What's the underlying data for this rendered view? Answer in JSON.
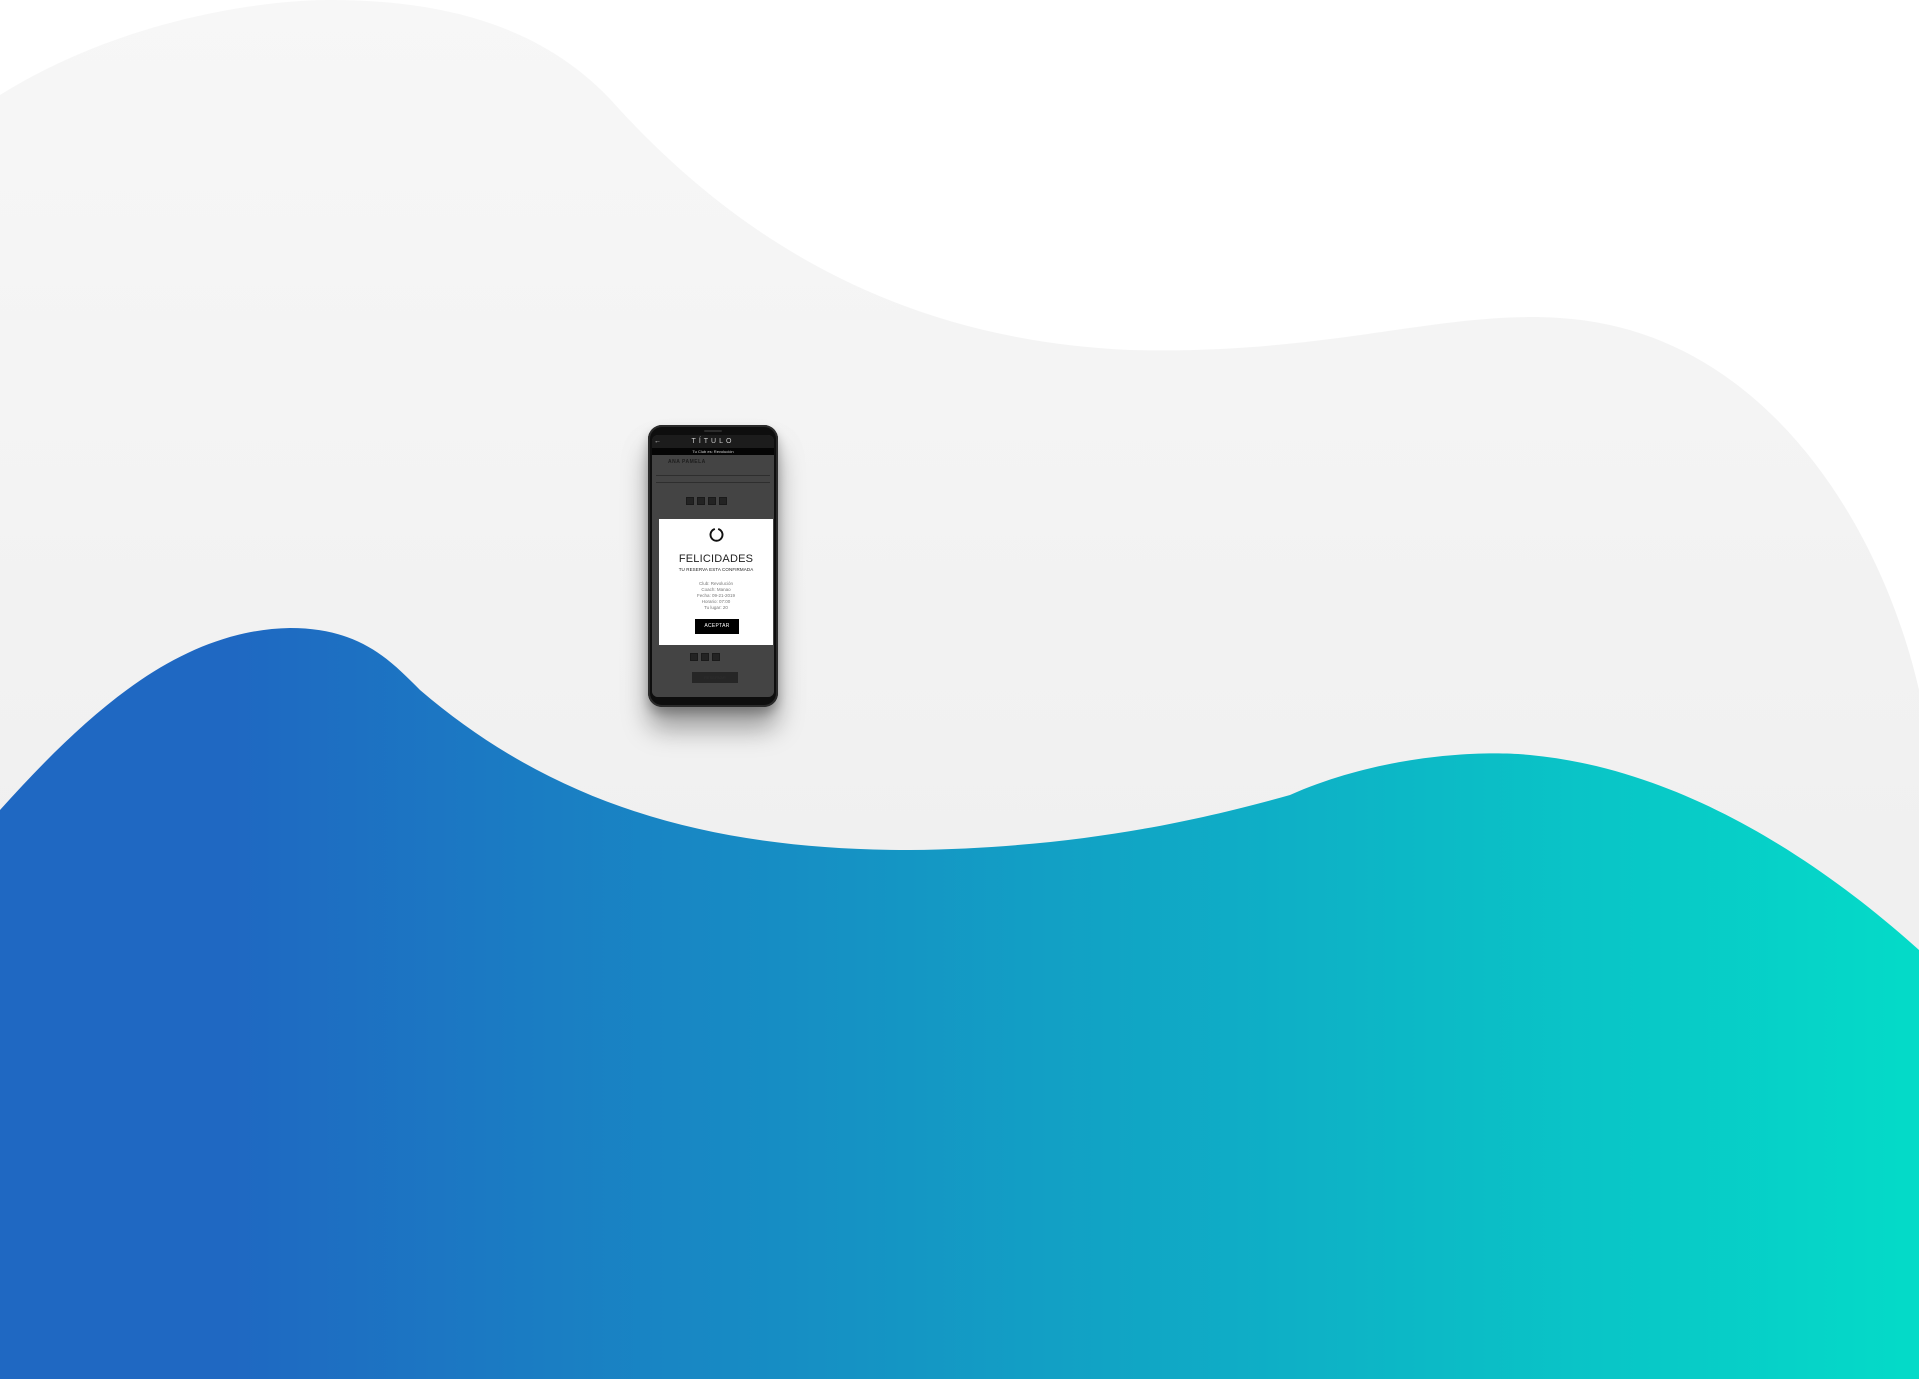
{
  "colors": {
    "wave_start": "#1f68c2",
    "wave_end": "#04dbc8",
    "grey_wave": "#efefef",
    "background": "#ffffff"
  },
  "phone": {
    "app": {
      "header_title": "TÍTULO",
      "back_icon": "arrow-left-icon",
      "club_bar_text": "Tu Club es: Revolución",
      "coach_name": "ANA PAMELA"
    },
    "modal": {
      "icon": "loading-ring-icon",
      "title": "FELICIDADES",
      "subtitle": "TU RESERVA ESTA CONFIRMADA",
      "details": [
        "Club: Revolución",
        "Coach: Manao",
        "Fecha: 09-21-2019",
        "Horario: 07:00",
        "Tu lugar: 20"
      ],
      "accept_label": "ACEPTAR"
    },
    "background_button_label": "RESERVAR"
  }
}
